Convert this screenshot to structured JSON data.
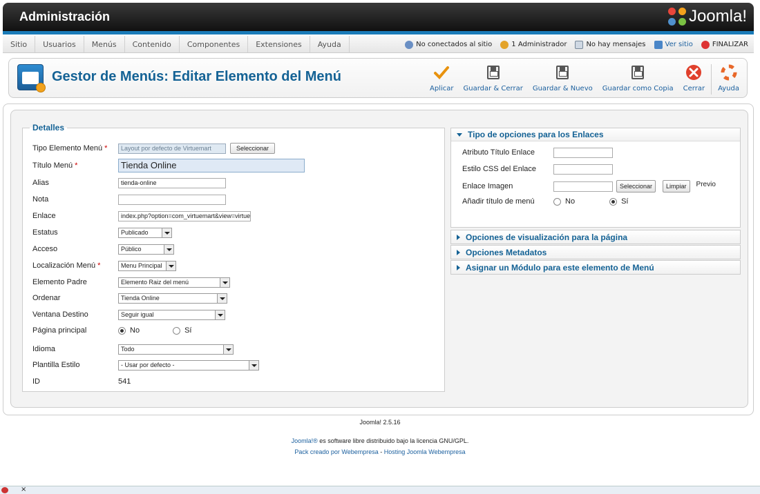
{
  "header": {
    "title": "Administración",
    "logo_text": "Joomla!"
  },
  "menubar": {
    "items": [
      "Sitio",
      "Usuarios",
      "Menús",
      "Contenido",
      "Componentes",
      "Extensiones",
      "Ayuda"
    ],
    "status": {
      "offline": "No conectados al sitio",
      "admins": "1 Administrador",
      "messages": "No hay mensajes",
      "view_site": "Ver sitio",
      "logout": "FINALIZAR"
    }
  },
  "toolbar": {
    "page_title": "Gestor de Menús: Editar Elemento del Menú",
    "buttons": [
      "Aplicar",
      "Guardar & Cerrar",
      "Guardar & Nuevo",
      "Guardar como Copia",
      "Cerrar",
      "Ayuda"
    ]
  },
  "details": {
    "legend": "Detalles",
    "type_label": "Tipo Elemento Menú",
    "type_value": "Layout por defecto de Virtuemart",
    "select_button": "Seleccionar",
    "title_label": "Título Menú",
    "title_value": "Tienda Online",
    "alias_label": "Alias",
    "alias_value": "tienda-online",
    "note_label": "Nota",
    "note_value": "",
    "link_label": "Enlace",
    "link_value": "index.php?option=com_virtuemart&view=virtue",
    "status_label": "Estatus",
    "status_value": "Publicado",
    "access_label": "Acceso",
    "access_value": "Público",
    "location_label": "Localización Menú",
    "location_value": "Menu Principal",
    "parent_label": "Elemento Padre",
    "parent_value": "Elemento Raiz del menú",
    "order_label": "Ordenar",
    "order_value": "Tienda Online",
    "target_label": "Ventana Destino",
    "target_value": "Seguir igual",
    "home_label": "Página principal",
    "home_no": "No",
    "home_yes": "Sí",
    "lang_label": "Idioma",
    "lang_value": "Todo",
    "style_label": "Plantilla Estilo",
    "style_value": "- Usar por defecto -",
    "id_label": "ID",
    "id_value": "541"
  },
  "link_options": {
    "header": "Tipo de opciones para los Enlaces",
    "title_attr_label": "Atributo Título Enlace",
    "css_label": "Estilo CSS del Enlace",
    "image_label": "Enlace Imagen",
    "select_button": "Seleccionar",
    "clear_button": "Limpiar",
    "preview": "Previo",
    "add_title_label": "Añadir título de menú",
    "no": "No",
    "yes": "Sí"
  },
  "accordion": [
    "Opciones de visualización para la página",
    "Opciones Metadatos",
    "Asignar un Módulo para este elemento de Menú"
  ],
  "footer": {
    "version": "Joomla! 2.5.16",
    "license_link": "Joomla!®",
    "license_text": " es software libre distribuido bajo la licencia GNU/GPL.",
    "pack_link": "Pack creado por Webempresa",
    "dash": " - ",
    "hosting_link": "Hosting Joomla Webempresa"
  },
  "colors": {
    "accent": "#146295",
    "header_bar": "#1a7bb8"
  }
}
